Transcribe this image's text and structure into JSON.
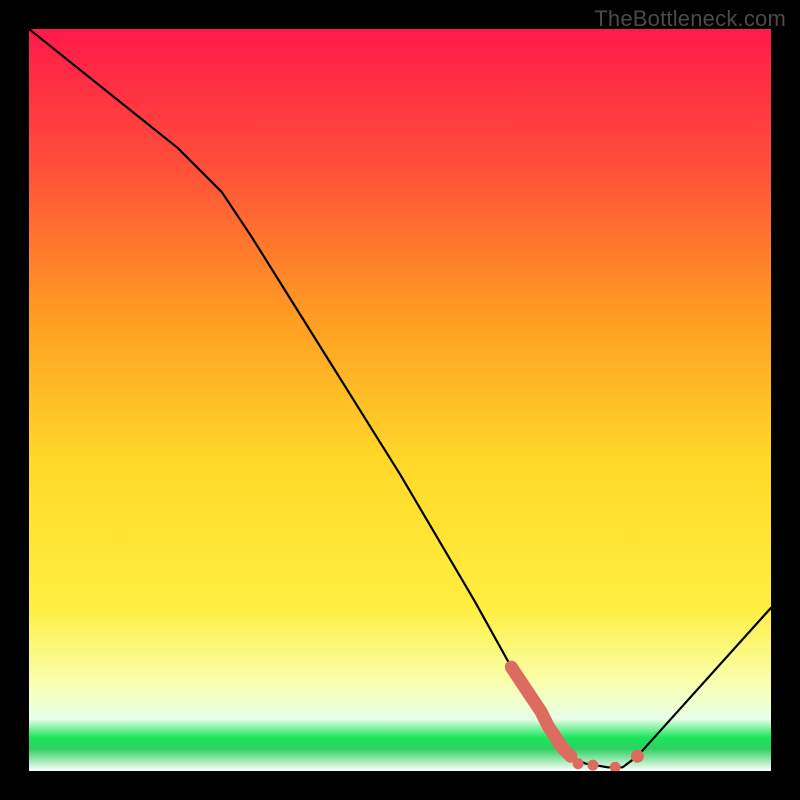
{
  "watermark": "TheBottleneck.com",
  "chart_data": {
    "type": "line",
    "title": "",
    "xlabel": "",
    "ylabel": "",
    "xlim": [
      0,
      100
    ],
    "ylim": [
      0,
      100
    ],
    "grid": false,
    "background_gradient": {
      "top": "#ff1a4a",
      "upper_mid": "#ff8a1f",
      "mid": "#ffe92e",
      "lower_mid": "#f6ff8a",
      "green_band": "#19e65a",
      "bottom": "#ffffff"
    },
    "series": [
      {
        "name": "curve",
        "stroke": "#000000",
        "x": [
          0,
          10,
          20,
          26,
          30,
          40,
          50,
          60,
          65,
          70,
          73,
          75,
          78,
          80,
          82,
          100
        ],
        "y": [
          100,
          92,
          84,
          78,
          72,
          56,
          40,
          23,
          14,
          6,
          2,
          1,
          0.5,
          0.5,
          2,
          22
        ]
      }
    ],
    "highlight_segment": {
      "description": "thick salmon trace along curve near minimum",
      "color": "#dd6b5f",
      "points_x": [
        65,
        67,
        69,
        70,
        71,
        72,
        73,
        75,
        77,
        78,
        80,
        82
      ],
      "points_y": [
        14,
        11,
        8,
        6,
        4.5,
        3,
        2,
        1,
        0.7,
        0.5,
        0.5,
        2
      ],
      "dot_x": [
        74,
        76,
        79,
        82
      ],
      "dot_y": [
        1,
        0.8,
        0.5,
        2
      ]
    }
  }
}
